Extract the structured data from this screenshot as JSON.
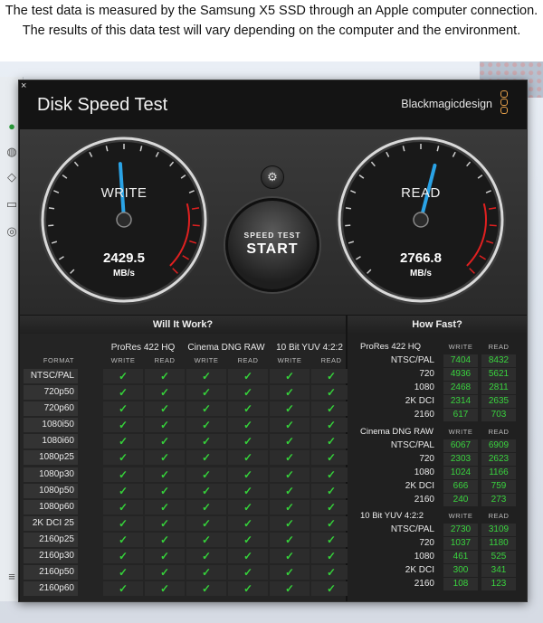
{
  "caption": {
    "line1": "The test data is measured by the Samsung X5 SSD through an Apple computer connection.",
    "line2": "The results of this data test will vary depending on the computer and the environment."
  },
  "window": {
    "title": "Disk Speed Test",
    "brand": "Blackmagicdesign",
    "close": "×"
  },
  "gauges": {
    "write": {
      "label": "WRITE",
      "value": "2429.5",
      "unit": "MB/s",
      "needle_value": 2429.5
    },
    "read": {
      "label": "READ",
      "value": "2766.8",
      "unit": "MB/s",
      "needle_value": 2766.8
    }
  },
  "start_button": {
    "small": "SPEED TEST",
    "big": "START"
  },
  "settings_icon": "⚙",
  "will_it_work": {
    "title": "Will It Work?",
    "format_label": "FORMAT",
    "codecs": [
      "ProRes 422 HQ",
      "Cinema DNG RAW",
      "10 Bit YUV 4:2:2"
    ],
    "write_label": "WRITE",
    "read_label": "READ",
    "check": "✓",
    "formats": [
      "NTSC/PAL",
      "720p50",
      "720p60",
      "1080i50",
      "1080i60",
      "1080p25",
      "1080p30",
      "1080p50",
      "1080p60",
      "2K DCI 25",
      "2160p25",
      "2160p30",
      "2160p50",
      "2160p60"
    ]
  },
  "how_fast": {
    "title": "How Fast?",
    "write_label": "WRITE",
    "read_label": "READ",
    "groups": [
      {
        "codec": "ProRes 422 HQ",
        "rows": [
          {
            "format": "NTSC/PAL",
            "write": "7404",
            "read": "8432"
          },
          {
            "format": "720",
            "write": "4936",
            "read": "5621"
          },
          {
            "format": "1080",
            "write": "2468",
            "read": "2811"
          },
          {
            "format": "2K DCI",
            "write": "2314",
            "read": "2635"
          },
          {
            "format": "2160",
            "write": "617",
            "read": "703"
          }
        ]
      },
      {
        "codec": "Cinema DNG RAW",
        "rows": [
          {
            "format": "NTSC/PAL",
            "write": "6067",
            "read": "6909"
          },
          {
            "format": "720",
            "write": "2303",
            "read": "2623"
          },
          {
            "format": "1080",
            "write": "1024",
            "read": "1166"
          },
          {
            "format": "2K DCI",
            "write": "666",
            "read": "759"
          },
          {
            "format": "2160",
            "write": "240",
            "read": "273"
          }
        ]
      },
      {
        "codec": "10 Bit YUV 4:2:2",
        "rows": [
          {
            "format": "NTSC/PAL",
            "write": "2730",
            "read": "3109"
          },
          {
            "format": "720",
            "write": "1037",
            "read": "1180"
          },
          {
            "format": "1080",
            "write": "461",
            "read": "525"
          },
          {
            "format": "2K DCI",
            "write": "300",
            "read": "341"
          },
          {
            "format": "2160",
            "write": "108",
            "read": "123"
          }
        ]
      }
    ]
  }
}
